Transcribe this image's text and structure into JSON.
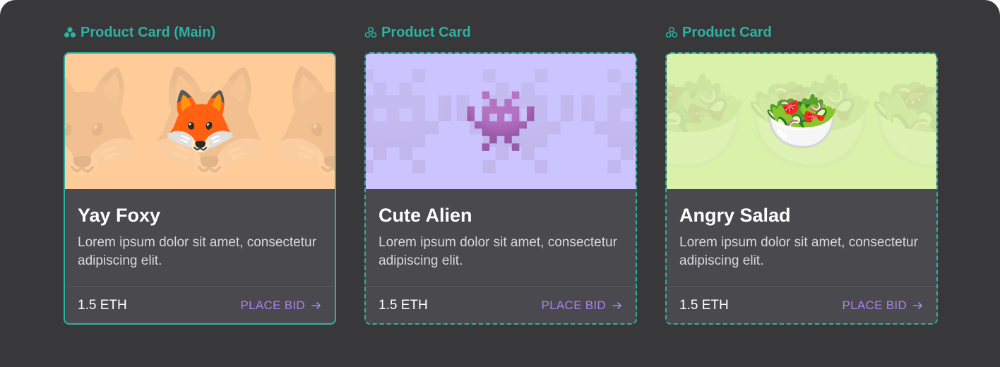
{
  "colors": {
    "background": "#38383a",
    "accent": "#2bb3a3",
    "card_body": "#4a494d",
    "bid": "#a983f0"
  },
  "variants": [
    {
      "title": "Product Card (Main)",
      "icon": "component-main-icon",
      "card": {
        "hero_color": "#ffcb98",
        "emoji": "🦊",
        "name": "Yay Foxy",
        "description": "Lorem ipsum dolor sit amet, consectetur adipiscing elit.",
        "price": "1.5 ETH",
        "bid_label": "PLACE BID"
      }
    },
    {
      "title": "Product Card",
      "icon": "component-instance-icon",
      "card": {
        "hero_color": "#ccc4fe",
        "emoji": "👾",
        "name": "Cute Alien",
        "description": "Lorem ipsum dolor sit amet, consectetur adipiscing elit.",
        "price": "1.5 ETH",
        "bid_label": "PLACE BID"
      }
    },
    {
      "title": "Product Card",
      "icon": "component-instance-icon",
      "card": {
        "hero_color": "#d9f1a8",
        "emoji": "🥗",
        "name": "Angry Salad",
        "description": "Lorem ipsum dolor sit amet, consectetur adipiscing elit.",
        "price": "1.5 ETH",
        "bid_label": "PLACE BID"
      }
    }
  ]
}
